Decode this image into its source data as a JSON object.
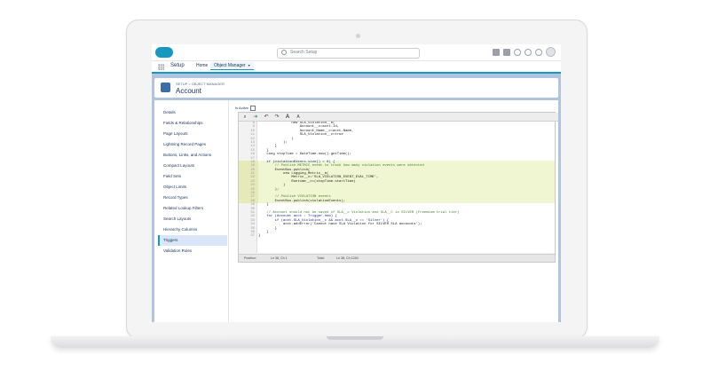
{
  "header": {
    "search_placeholder": "Search Setup"
  },
  "app_nav": {
    "app_name": "Setup",
    "tabs": [
      {
        "label": "Home"
      },
      {
        "label": "Object Manager"
      }
    ]
  },
  "object_header": {
    "breadcrumb": "SETUP > OBJECT MANAGER",
    "title": "Account"
  },
  "sidebar": {
    "items": [
      {
        "label": "Details"
      },
      {
        "label": "Fields & Relationships"
      },
      {
        "label": "Page Layouts"
      },
      {
        "label": "Lightning Record Pages"
      },
      {
        "label": "Buttons, Links, and Actions"
      },
      {
        "label": "Compact Layouts"
      },
      {
        "label": "Field Sets"
      },
      {
        "label": "Object Limits"
      },
      {
        "label": "Record Types"
      },
      {
        "label": "Related Lookup Filters"
      },
      {
        "label": "Search Layouts"
      },
      {
        "label": "Hierarchy Columns"
      },
      {
        "label": "Triggers"
      },
      {
        "label": "Validation Rules"
      }
    ],
    "active_index": 12
  },
  "editor": {
    "is_active_label": "Is Active",
    "toolbar_icons": [
      "search-icon",
      "arrow-right-icon",
      "undo-icon",
      "redo-icon",
      "font-larger-icon",
      "font-smaller-icon"
    ],
    "lines": [
      {
        "n": "",
        "text": "                new SLA_Violation__e(",
        "hl": false,
        "style": "code"
      },
      {
        "n": "",
        "text": "                    Account__c=acct.Id,",
        "hl": false,
        "style": "code"
      },
      {
        "n": "",
        "text": "                    Account_Name__c=acct.Name,",
        "hl": false,
        "style": "code"
      },
      {
        "n": "",
        "text": "                    SLA_Violation__c=true",
        "hl": false,
        "style": "code"
      },
      {
        "n": "",
        "text": "                )",
        "hl": false,
        "style": "code"
      },
      {
        "n": "",
        "text": "            );",
        "hl": false,
        "style": "code"
      },
      {
        "n": "",
        "text": "        }",
        "hl": false,
        "style": "code"
      },
      {
        "n": "",
        "text": "    }",
        "hl": false,
        "style": "code"
      },
      {
        "n": "",
        "text": "    Long stopTime = DateTime.now().getTime();",
        "hl": false,
        "style": "code"
      },
      {
        "n": "",
        "text": "",
        "hl": false,
        "style": "code"
      },
      {
        "n": "",
        "text": "    if (violationEvents.size() > 0) {",
        "hl": true,
        "style": "kw"
      },
      {
        "n": "",
        "text": "        // Publish METRIC event to track how many violation events were detected",
        "hl": true,
        "style": "cm"
      },
      {
        "n": "",
        "text": "        EventBus.publish(",
        "hl": true,
        "style": "code"
      },
      {
        "n": "",
        "text": "            new Logging_Metric__e(",
        "hl": true,
        "style": "code"
      },
      {
        "n": "",
        "text": "                Metric__c='SLA_VIOLATION_EVENT_EVAL_TIME',",
        "hl": true,
        "style": "code"
      },
      {
        "n": "",
        "text": "                Runtime__c=(stopTime-startTime)",
        "hl": true,
        "style": "code"
      },
      {
        "n": "",
        "text": "            )",
        "hl": true,
        "style": "code"
      },
      {
        "n": "",
        "text": "        );",
        "hl": true,
        "style": "code"
      },
      {
        "n": "",
        "text": "",
        "hl": true,
        "style": "code"
      },
      {
        "n": "",
        "text": "        // Publish VIOLATION events",
        "hl": true,
        "style": "cm"
      },
      {
        "n": "",
        "text": "        EventBus.publish(violationEvents);",
        "hl": true,
        "style": "code"
      },
      {
        "n": "",
        "text": "    }",
        "hl": false,
        "style": "code"
      },
      {
        "n": "",
        "text": "",
        "hl": false,
        "style": "code"
      },
      {
        "n": "",
        "text": "    // Account should not be saved if SLA__c Violation and SLA__C is SILVER (freemium trial tier)",
        "hl": false,
        "style": "cm"
      },
      {
        "n": "",
        "text": "    for (Account acct : Trigger.new) {",
        "hl": false,
        "style": "kw"
      },
      {
        "n": "",
        "text": "        if (acct.SLA_Violation__c && acct.SLA__c == 'Silver') {",
        "hl": false,
        "style": "kw"
      },
      {
        "n": "",
        "text": "            acct.addError('Cannot have SLA Violation for SILVER SLA accounts');",
        "hl": false,
        "style": "code"
      },
      {
        "n": "",
        "text": "        }",
        "hl": false,
        "style": "code"
      },
      {
        "n": "",
        "text": "    }",
        "hl": false,
        "style": "code"
      },
      {
        "n": "",
        "text": "}",
        "hl": false,
        "style": "code"
      }
    ],
    "status": {
      "position_label": "Position:",
      "position_value": "Ln 36, Ch 1",
      "total_label": "Total:",
      "total_value": "Ln 38, Ch 1240"
    }
  },
  "colors": {
    "brand": "#1798c1",
    "nav_text": "#16325c",
    "page_bg": "#b0c4df",
    "highlight": "#f0f6d2"
  }
}
